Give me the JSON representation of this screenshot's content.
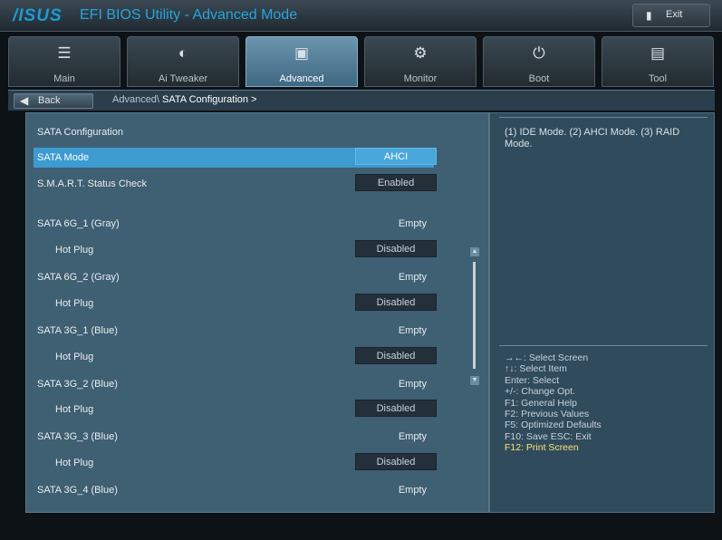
{
  "header": {
    "logo": "/ISUS",
    "title": "EFI BIOS Utility - Advanced Mode",
    "exit_label": "Exit"
  },
  "tabs": [
    {
      "label": "Main",
      "icon": "list-icon"
    },
    {
      "label": "Ai Tweaker",
      "icon": "tweaker-icon"
    },
    {
      "label": "Advanced",
      "icon": "advanced-icon",
      "active": true
    },
    {
      "label": "Monitor",
      "icon": "monitor-icon"
    },
    {
      "label": "Boot",
      "icon": "power-icon"
    },
    {
      "label": "Tool",
      "icon": "tool-icon"
    }
  ],
  "breadcrumb": {
    "back_label": "Back",
    "path": "Advanced\\",
    "current": "SATA Configuration >"
  },
  "settings": {
    "section_title": "SATA Configuration",
    "items": [
      {
        "label": "SATA Mode",
        "value": "AHCI"
      },
      {
        "label": "S.M.A.R.T. Status Check",
        "value": "Enabled"
      },
      {
        "label": "SATA 6G_1 (Gray)",
        "value": "Empty"
      },
      {
        "label": "Hot Plug",
        "value": "Disabled"
      },
      {
        "label": "SATA 6G_2 (Gray)",
        "value": "Empty"
      },
      {
        "label": "Hot Plug",
        "value": "Disabled"
      },
      {
        "label": "SATA 3G_1 (Blue)",
        "value": "Empty"
      },
      {
        "label": "Hot Plug",
        "value": "Disabled"
      },
      {
        "label": "SATA 3G_2 (Blue)",
        "value": "Empty"
      },
      {
        "label": "Hot Plug",
        "value": "Disabled"
      },
      {
        "label": "SATA 3G_3 (Blue)",
        "value": "Empty"
      },
      {
        "label": "Hot Plug",
        "value": "Disabled"
      },
      {
        "label": "SATA 3G_4 (Blue)",
        "value": "Empty"
      }
    ]
  },
  "help": {
    "description": "(1) IDE Mode. (2) AHCI Mode. (3) RAID Mode.",
    "keys": [
      "→←: Select Screen",
      "↑↓: Select Item",
      "Enter: Select",
      "+/-: Change Opt.",
      "F1: General Help",
      "F2: Previous Values",
      "F5: Optimized Defaults",
      "F10: Save   ESC: Exit",
      "F12: Print Screen"
    ]
  },
  "colors": {
    "accent": "#3d9bd0",
    "highlight_key": "#ffe37a",
    "panel": "#3f5f72"
  }
}
